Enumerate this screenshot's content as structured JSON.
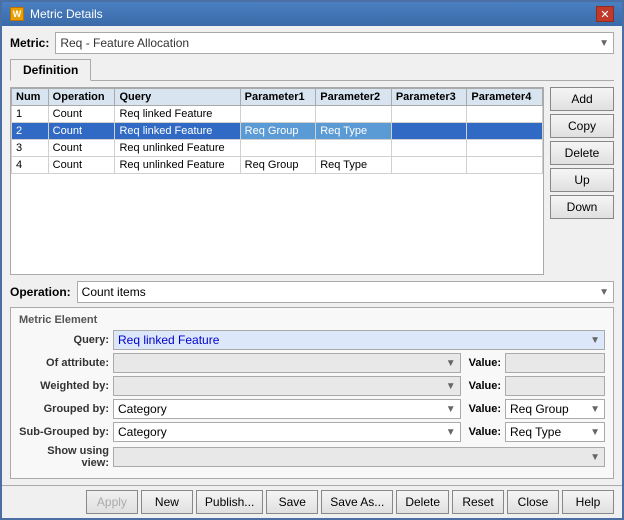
{
  "window": {
    "title": "Metric Details",
    "icon": "W"
  },
  "metric": {
    "label": "Metric:",
    "value": "Req - Feature Allocation"
  },
  "tabs": [
    {
      "id": "definition",
      "label": "Definition",
      "active": true
    }
  ],
  "table": {
    "columns": [
      "Num",
      "Operation",
      "Query",
      "Parameter1",
      "Parameter2",
      "Parameter3",
      "Parameter4"
    ],
    "rows": [
      {
        "num": "1",
        "operation": "Count",
        "query": "Req linked Feature",
        "p1": "",
        "p2": "",
        "p3": "",
        "p4": "",
        "selected": false
      },
      {
        "num": "2",
        "operation": "Count",
        "query": "Req linked Feature",
        "p1": "Req Group",
        "p2": "Req Type",
        "p3": "",
        "p4": "",
        "selected": true
      },
      {
        "num": "3",
        "operation": "Count",
        "query": "Req unlinked Feature",
        "p1": "",
        "p2": "",
        "p3": "",
        "p4": "",
        "selected": false
      },
      {
        "num": "4",
        "operation": "Count",
        "query": "Req unlinked Feature",
        "p1": "Req Group",
        "p2": "Req Type",
        "p3": "",
        "p4": "",
        "selected": false
      }
    ]
  },
  "buttons": {
    "add": "Add",
    "copy": "Copy",
    "delete": "Delete",
    "up": "Up",
    "down": "Down"
  },
  "operation": {
    "label": "Operation:",
    "value": "Count items"
  },
  "metric_element": {
    "title": "Metric Element",
    "query_label": "Query:",
    "query_value": "Req linked Feature",
    "of_attribute_label": "Of attribute:",
    "of_attribute_value": "",
    "weighted_by_label": "Weighted by:",
    "weighted_by_value": "",
    "grouped_by_label": "Grouped by:",
    "grouped_by_value": "Category",
    "grouped_by_value_label": "Value:",
    "grouped_by_value_value": "Req Group",
    "sub_grouped_by_label": "Sub-Grouped by:",
    "sub_grouped_by_value": "Category",
    "sub_grouped_by_value_label": "Value:",
    "sub_grouped_by_value_value": "Req Type",
    "show_using_view_label": "Show using view:",
    "show_using_view_value": ""
  },
  "bottom_buttons": {
    "apply": "Apply",
    "new": "New",
    "publish": "Publish...",
    "save": "Save",
    "save_as": "Save As...",
    "delete": "Delete",
    "reset": "Reset",
    "close": "Close",
    "help": "Help"
  }
}
